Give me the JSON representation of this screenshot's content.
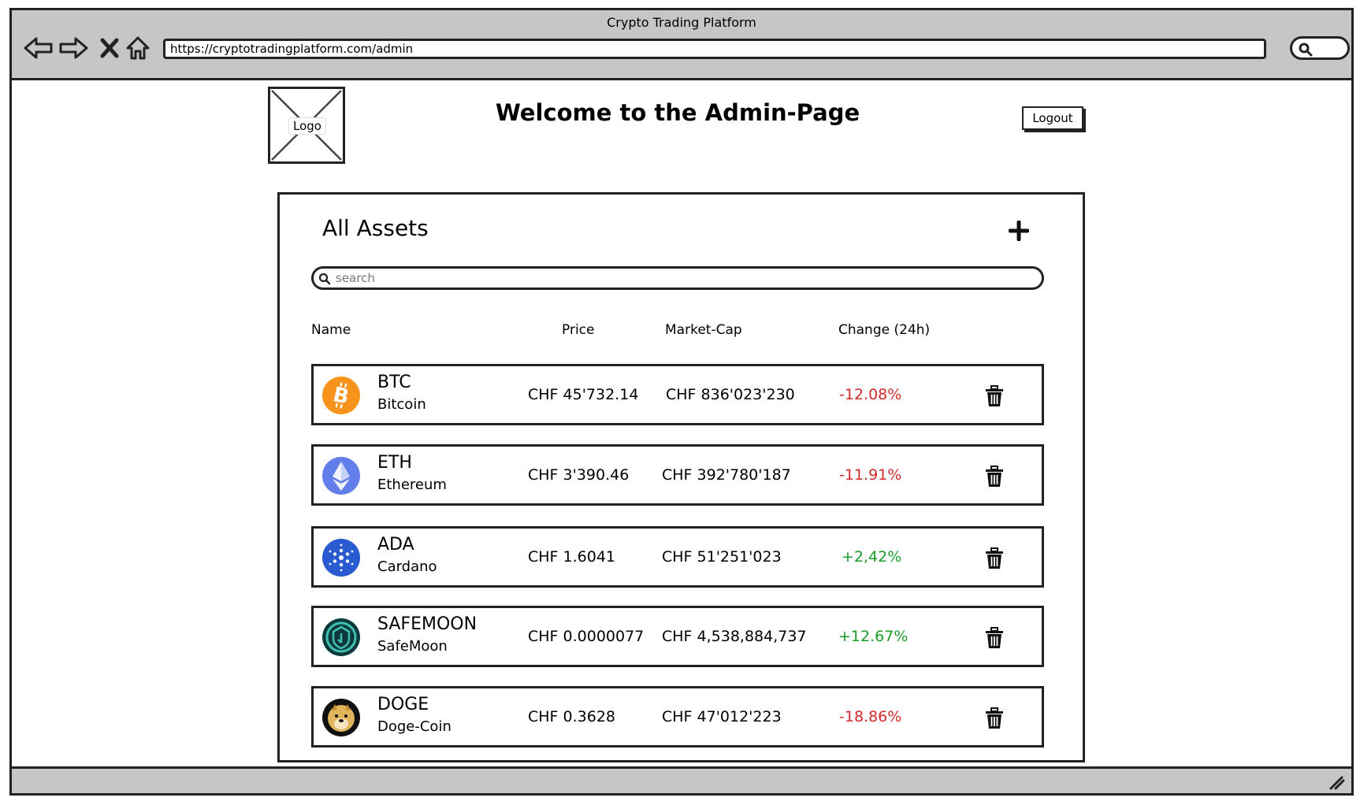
{
  "browser": {
    "title": "Crypto Trading Platform",
    "url": "https://cryptotradingplatform.com/admin"
  },
  "header": {
    "logo_label": "Logo",
    "title": "Welcome to the Admin-Page",
    "logout_label": "Logout"
  },
  "assets_panel": {
    "title": "All Assets",
    "search_placeholder": "search",
    "columns": {
      "name": "Name",
      "price": "Price",
      "market_cap": "Market-Cap",
      "change": "Change (24h)"
    },
    "rows": [
      {
        "ticker": "BTC",
        "name": "Bitcoin",
        "price": "CHF 45'732.14",
        "market_cap": "CHF 836'023'230",
        "change": "-12.08%",
        "icon": "bitcoin-icon",
        "icon_color": "#f7931a"
      },
      {
        "ticker": "ETH",
        "name": "Ethereum",
        "price": "CHF 3'390.46",
        "market_cap": "CHF 392'780'187",
        "change": "-11.91%",
        "icon": "ethereum-icon",
        "icon_color": "#627eea"
      },
      {
        "ticker": "ADA",
        "name": "Cardano",
        "price": "CHF 1.6041",
        "market_cap": "CHF 51'251'023",
        "change": "+2,42%",
        "icon": "cardano-icon",
        "icon_color": "#2a5ad0"
      },
      {
        "ticker": "SAFEMOON",
        "name": "SafeMoon",
        "price": "CHF 0.0000077",
        "market_cap": "CHF 4,538,884,737",
        "change": "+12.67%",
        "icon": "safemoon-icon",
        "icon_color": "#0e3a3e"
      },
      {
        "ticker": "DOGE",
        "name": "Doge-Coin",
        "price": "CHF 0.3628",
        "market_cap": "CHF 47'012'223",
        "change": "-18.86%",
        "icon": "doge-icon",
        "icon_color": "#c2a633"
      }
    ]
  },
  "colors": {
    "negative": "#d12b2b",
    "positive": "#1a9c2a",
    "chrome": "#c6c6c6"
  }
}
